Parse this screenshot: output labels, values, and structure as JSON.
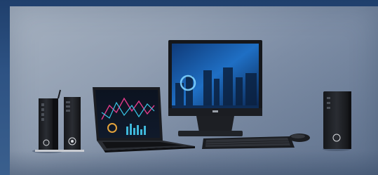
{
  "image": {
    "subject": "dell-product-lineup",
    "products": [
      {
        "icon": "thin-client-left-icon"
      },
      {
        "icon": "thin-client-right-icon"
      },
      {
        "icon": "laptop-icon"
      },
      {
        "icon": "all-in-one-desktop-icon"
      },
      {
        "icon": "keyboard-icon"
      },
      {
        "icon": "mouse-icon"
      },
      {
        "icon": "micro-desktop-icon"
      }
    ],
    "colors": {
      "background_outer": "#2a4c78",
      "panel": "#8e9cb0",
      "device_body": "#1d1f24",
      "screen_blue": "#1f6fc4"
    }
  }
}
